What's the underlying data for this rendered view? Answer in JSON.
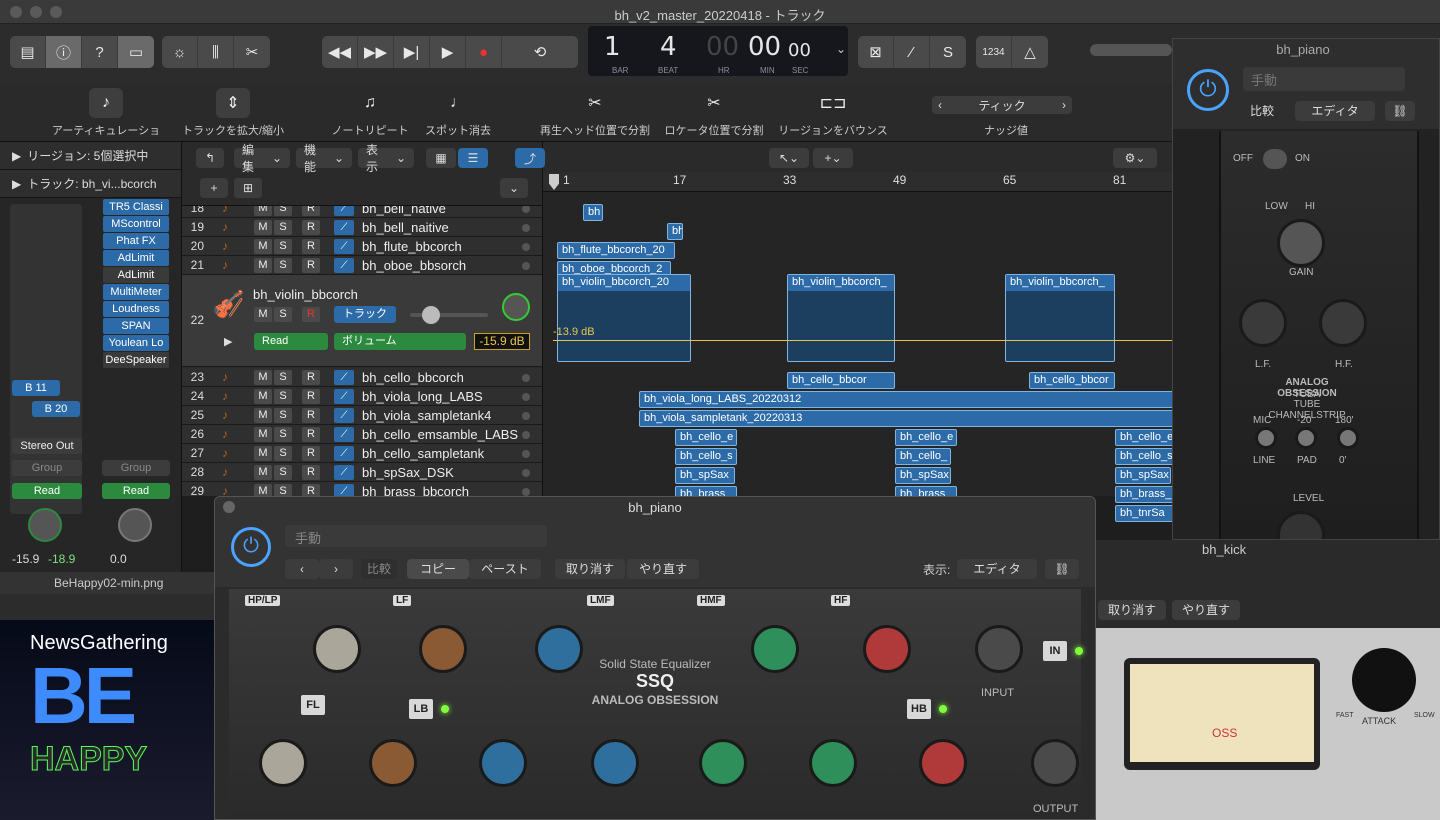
{
  "window": {
    "title": "bh_v2_master_20220418 - トラック"
  },
  "transport": {
    "bar": "1",
    "beat": "4",
    "hr": "00",
    "min": "00",
    "sec": "00",
    "bar_label": "BAR",
    "beat_label": "BEAT",
    "hr_label": "HR",
    "min_label": "MIN",
    "sec_label": "SEC",
    "count_label": "1234"
  },
  "toolbar": {
    "items": [
      "アーティキュレーション",
      "トラックを拡大/縮小",
      "ノートリピート",
      "スポット消去",
      "再生ヘッド位置で分割",
      "ロケータ位置で分割",
      "リージョンをバウンス"
    ],
    "nudge_label": "ティック",
    "nudge_caption": "ナッジ値"
  },
  "inspector": {
    "region_header": "リージョン: 5個選択中",
    "track_header": "トラック: bh_vi...bcorch",
    "plugins": [
      "TR5 Classi",
      "MScontrol",
      "Phat FX",
      "AdLimit",
      "AdLimit",
      "MultiMeter",
      "Loudness",
      "SPAN",
      "Youlean Lo",
      "DeeSpeaker"
    ],
    "bus1": "B 11",
    "bus2": "B 20",
    "output": "Stereo Out",
    "group1": "Group",
    "group2": "Group",
    "read1": "Read",
    "read2": "Read",
    "vol1": "-15.9",
    "vol2": "-18.9",
    "vol3": "0.0"
  },
  "trackhdr": {
    "edit": "編集",
    "func": "機能",
    "view": "表示"
  },
  "tracks": [
    {
      "num": "18",
      "name": "bh_bell_native"
    },
    {
      "num": "19",
      "name": "bh_bell_naitive"
    },
    {
      "num": "20",
      "name": "bh_flute_bbcorch"
    },
    {
      "num": "21",
      "name": "bh_oboe_bbsorch"
    },
    {
      "num": "22",
      "name": "bh_violin_bbcorch"
    },
    {
      "num": "23",
      "name": "bh_cello_bbcorch"
    },
    {
      "num": "24",
      "name": "bh_viola_long_LABS"
    },
    {
      "num": "25",
      "name": "bh_viola_sampletank4"
    },
    {
      "num": "26",
      "name": "bh_cello_emsamble_LABS"
    },
    {
      "num": "27",
      "name": "bh_cello_sampletank"
    },
    {
      "num": "28",
      "name": "bh_spSax_DSK"
    },
    {
      "num": "29",
      "name": "bh_brass_bbcorch"
    },
    {
      "num": "30",
      "name": ""
    },
    {
      "num": "31",
      "name": ""
    },
    {
      "num": "32",
      "name": ""
    },
    {
      "num": "33",
      "name": ""
    }
  ],
  "violin": {
    "track_btn": "トラック",
    "mode": "Read",
    "param": "ボリューム",
    "value": "-15.9 dB",
    "automation": "-13.9 dB"
  },
  "ruler": [
    "1",
    "17",
    "33",
    "49",
    "65",
    "81"
  ],
  "regions": {
    "bell": "bh",
    "flute": "bh_flute_bbcorch_20",
    "oboe": "bh_oboe_bbcorch_2",
    "violin1": "bh_violin_bbcorch_20",
    "violin2": "bh_violin_bbcorch_",
    "violin3": "bh_violin_bbcorch_",
    "cello1": "bh_cello_bbcor",
    "cello2": "bh_cello_bbcor",
    "viola_long": "bh_viola_long_LABS_20220312",
    "viola_st": "bh_viola_sampletank_20220313",
    "cello_e": "bh_cello_e",
    "cello_s": "bh_cello_s",
    "cello_s2": "bh_cello_",
    "spsax": "bh_spSax",
    "brass": "bh_brass_",
    "tnrsa": "bh_tnrSa",
    "rn": "rn"
  },
  "ssq": {
    "title": "bh_piano",
    "preset": "手動",
    "compare": "比較",
    "copy": "コピー",
    "paste": "ペースト",
    "undo": "取り消す",
    "redo": "やり直す",
    "view_label": "表示:",
    "view_value": "エディタ",
    "brand1": "Solid State Equalizer",
    "brand2": "SSQ",
    "brand3": "ANALOG OBSESSION",
    "sections": [
      "HP/LP",
      "LF",
      "LMF",
      "HMF",
      "HF"
    ],
    "fl": "FL",
    "lb": "LB",
    "hb": "HB",
    "in": "IN",
    "input": "INPUT",
    "output": "OUTPUT"
  },
  "tube": {
    "title": "bh_piano",
    "preset": "手動",
    "compare": "比較",
    "view": "エディタ",
    "off": "OFF",
    "on": "ON",
    "low": "LOW",
    "hi": "HI",
    "gain": "GAIN",
    "lf": "L.F.",
    "hf": "H.F.",
    "name1": "ANALOG OBSESSION",
    "name2": "TUBA",
    "name3": "TUBE CHANNELSTRIP",
    "mic": "MIC",
    "line": "LINE",
    "pad": "PAD",
    "v20": "-20",
    "v180": "180'",
    "v0": "0'",
    "level": "LEVEL"
  },
  "kick": {
    "title": "bh_kick",
    "undo": "取り消す",
    "redo": "やり直す",
    "brand": "OSS",
    "attack": "ATTACK",
    "fast": "FAST",
    "slow": "SLOW"
  },
  "imgwin": {
    "title": "BeHappy02-min.png",
    "text1": "NewsGathering",
    "text2": "BE",
    "text3": "HAPPY"
  },
  "colors": {
    "accent": "#2c6ba8",
    "green_read": "#2b8a3e",
    "led": "#7fff3a"
  }
}
